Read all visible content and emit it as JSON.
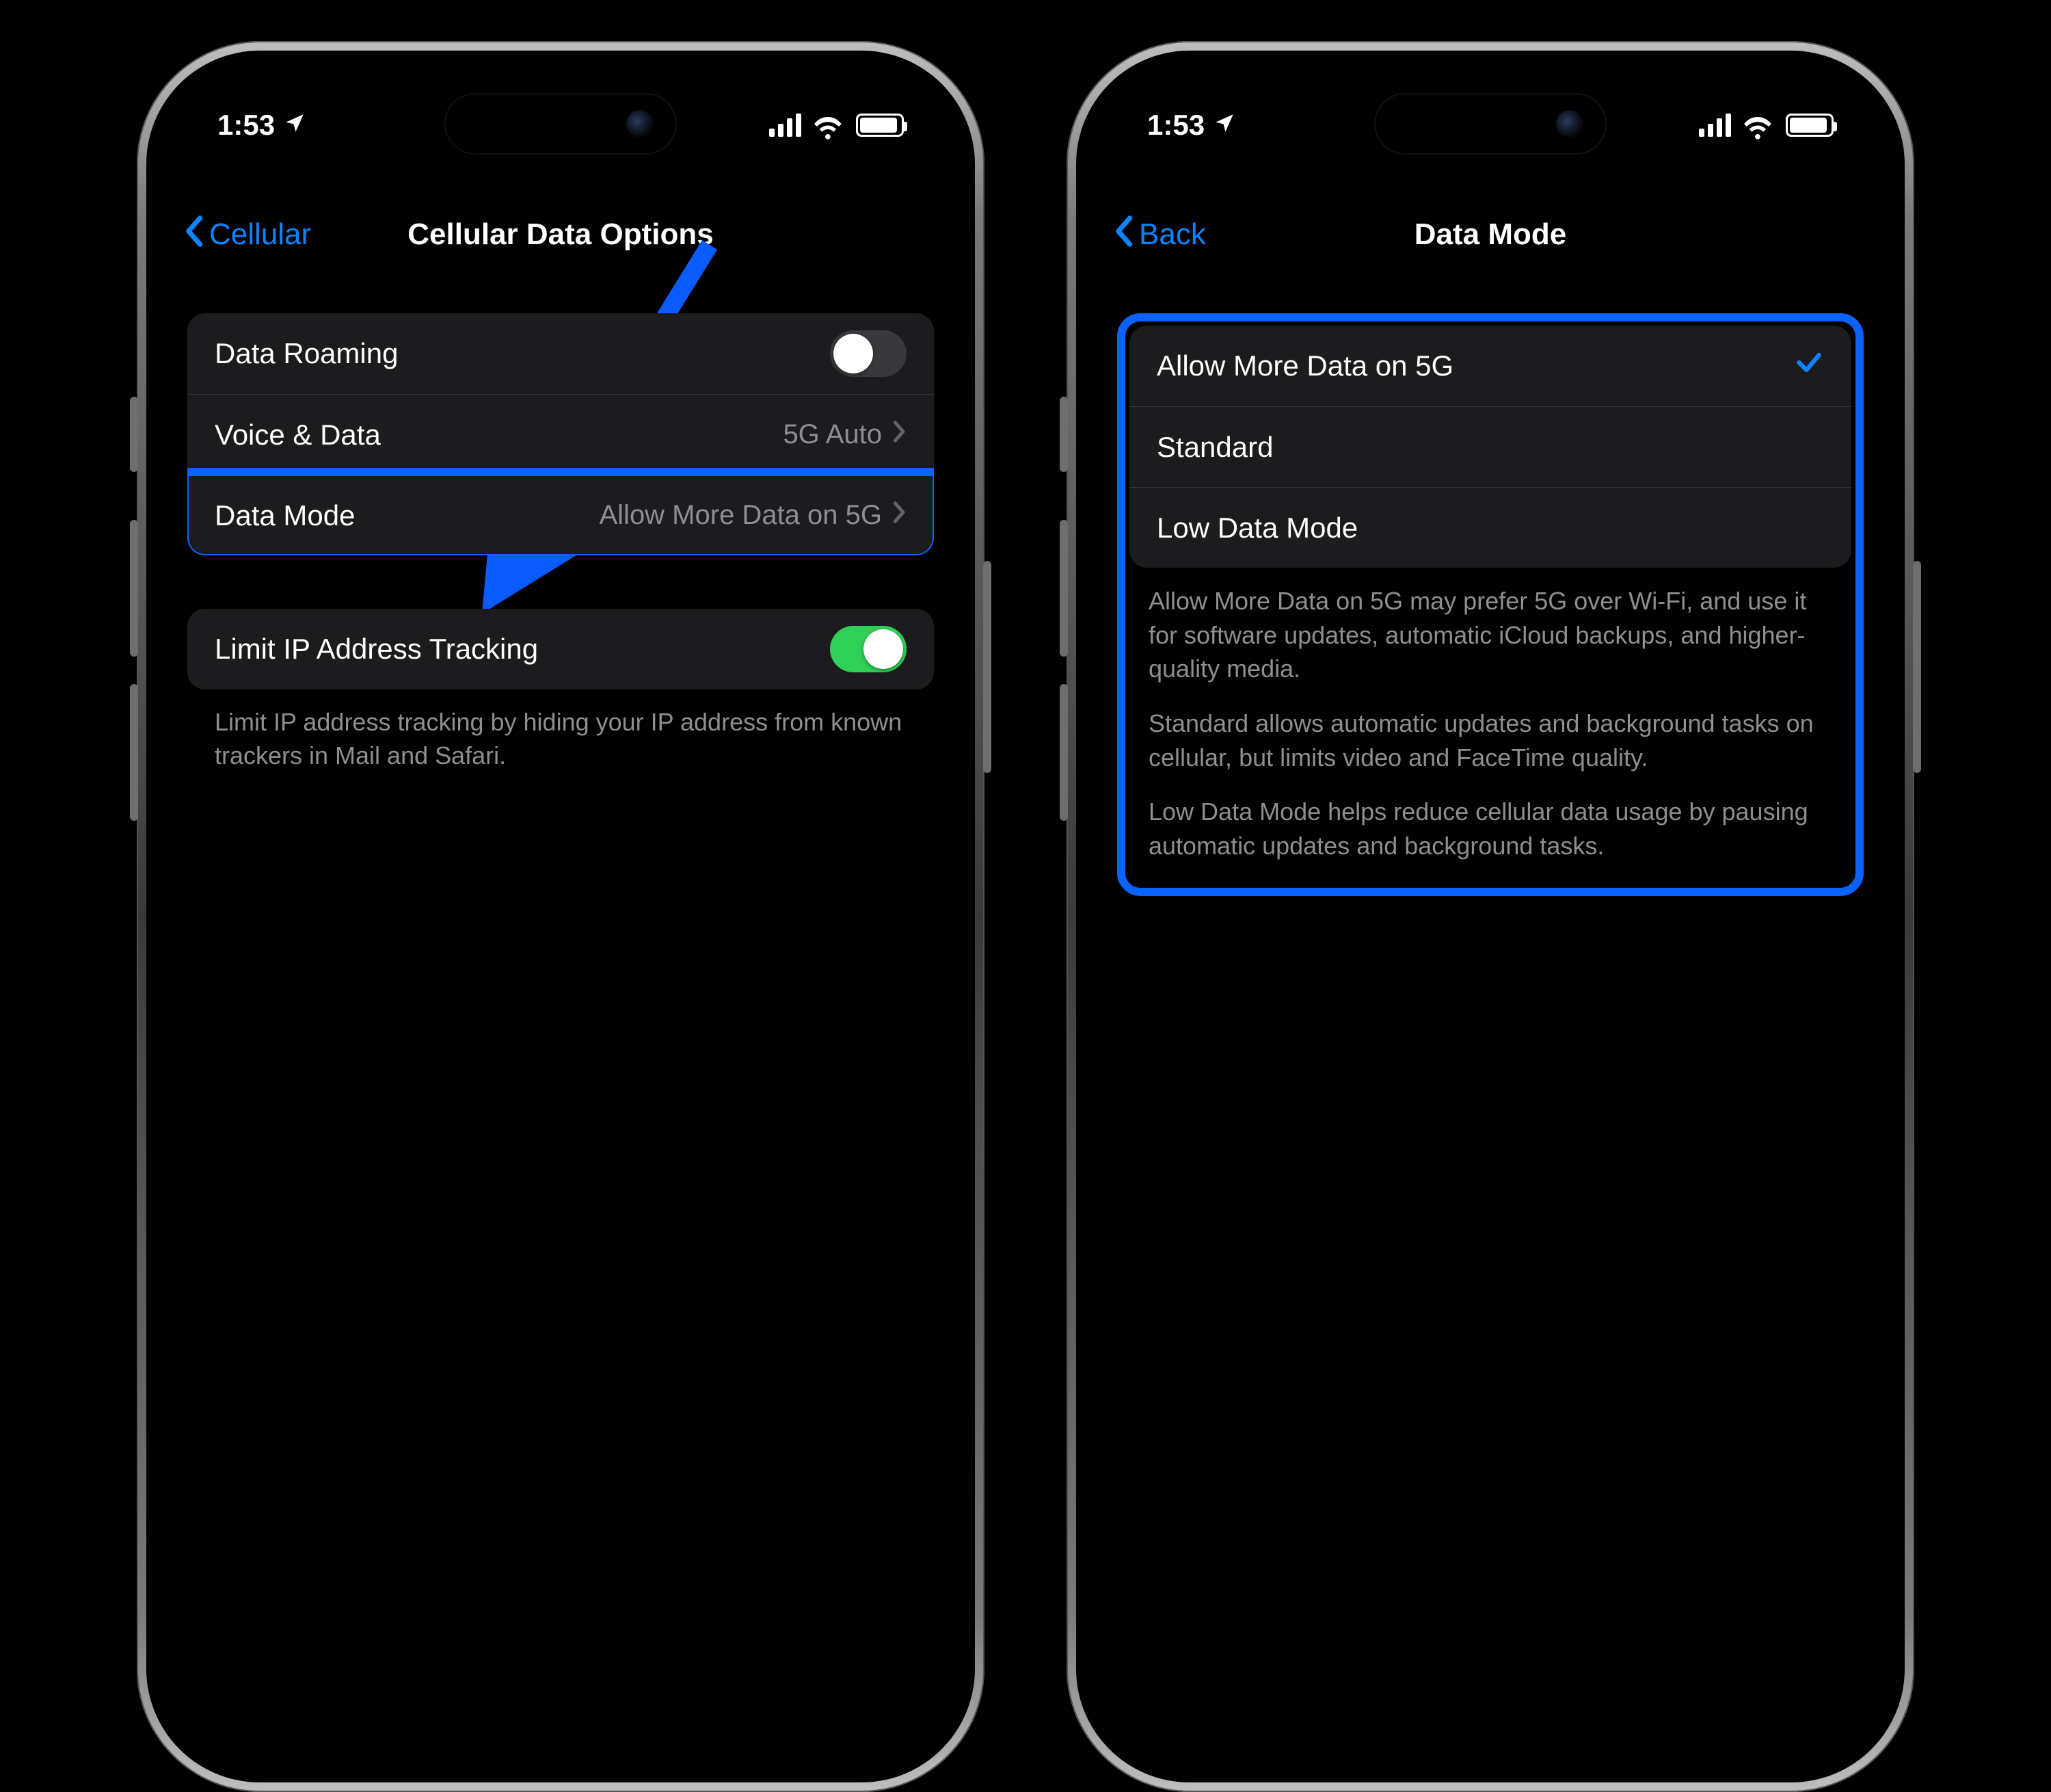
{
  "status": {
    "time": "1:53"
  },
  "left": {
    "nav": {
      "back": "Cellular",
      "title": "Cellular Data Options"
    },
    "rows": {
      "roaming": {
        "label": "Data Roaming",
        "on": false
      },
      "voice": {
        "label": "Voice & Data",
        "value": "5G Auto"
      },
      "mode": {
        "label": "Data Mode",
        "value": "Allow More Data on 5G"
      }
    },
    "ip": {
      "label": "Limit IP Address Tracking",
      "on": true,
      "note": "Limit IP address tracking by hiding your IP address from known trackers in Mail and Safari."
    }
  },
  "right": {
    "nav": {
      "back": "Back",
      "title": "Data Mode"
    },
    "options": [
      {
        "label": "Allow More Data on 5G",
        "selected": true
      },
      {
        "label": "Standard",
        "selected": false
      },
      {
        "label": "Low Data Mode",
        "selected": false
      }
    ],
    "desc": {
      "p1": "Allow More Data on 5G may prefer 5G over Wi-Fi, and use it for software updates, automatic iCloud backups, and higher-quality media.",
      "p2": "Standard allows automatic updates and background tasks on cellular, but limits video and FaceTime quality.",
      "p3": "Low Data Mode helps reduce cellular data usage by pausing automatic updates and background tasks."
    }
  }
}
